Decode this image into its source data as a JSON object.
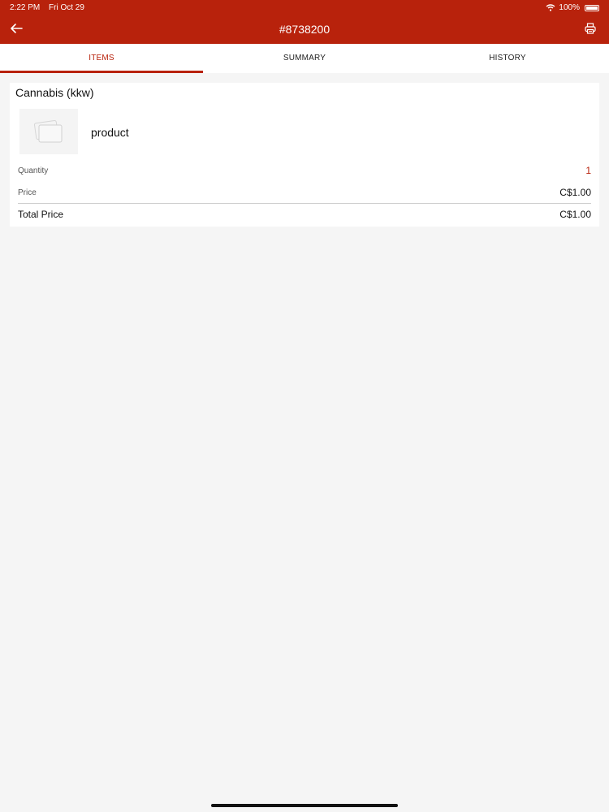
{
  "status_bar": {
    "time": "2:22 PM",
    "date": "Fri Oct 29",
    "battery": "100%"
  },
  "header": {
    "title": "#8738200"
  },
  "tabs": [
    {
      "label": "ITEMS",
      "active": true
    },
    {
      "label": "SUMMARY",
      "active": false
    },
    {
      "label": "HISTORY",
      "active": false
    }
  ],
  "item": {
    "category": "Cannabis (kkw)",
    "product_name": "product",
    "quantity_label": "Quantity",
    "quantity_value": "1",
    "price_label": "Price",
    "price_value": "C$1.00",
    "total_label": "Total Price",
    "total_value": "C$1.00"
  },
  "colors": {
    "accent": "#b8220c",
    "background": "#f5f5f5",
    "card": "#ffffff"
  },
  "icons": [
    "back-arrow-icon",
    "printer-icon",
    "wifi-icon",
    "battery-icon",
    "image-placeholder-icon"
  ]
}
